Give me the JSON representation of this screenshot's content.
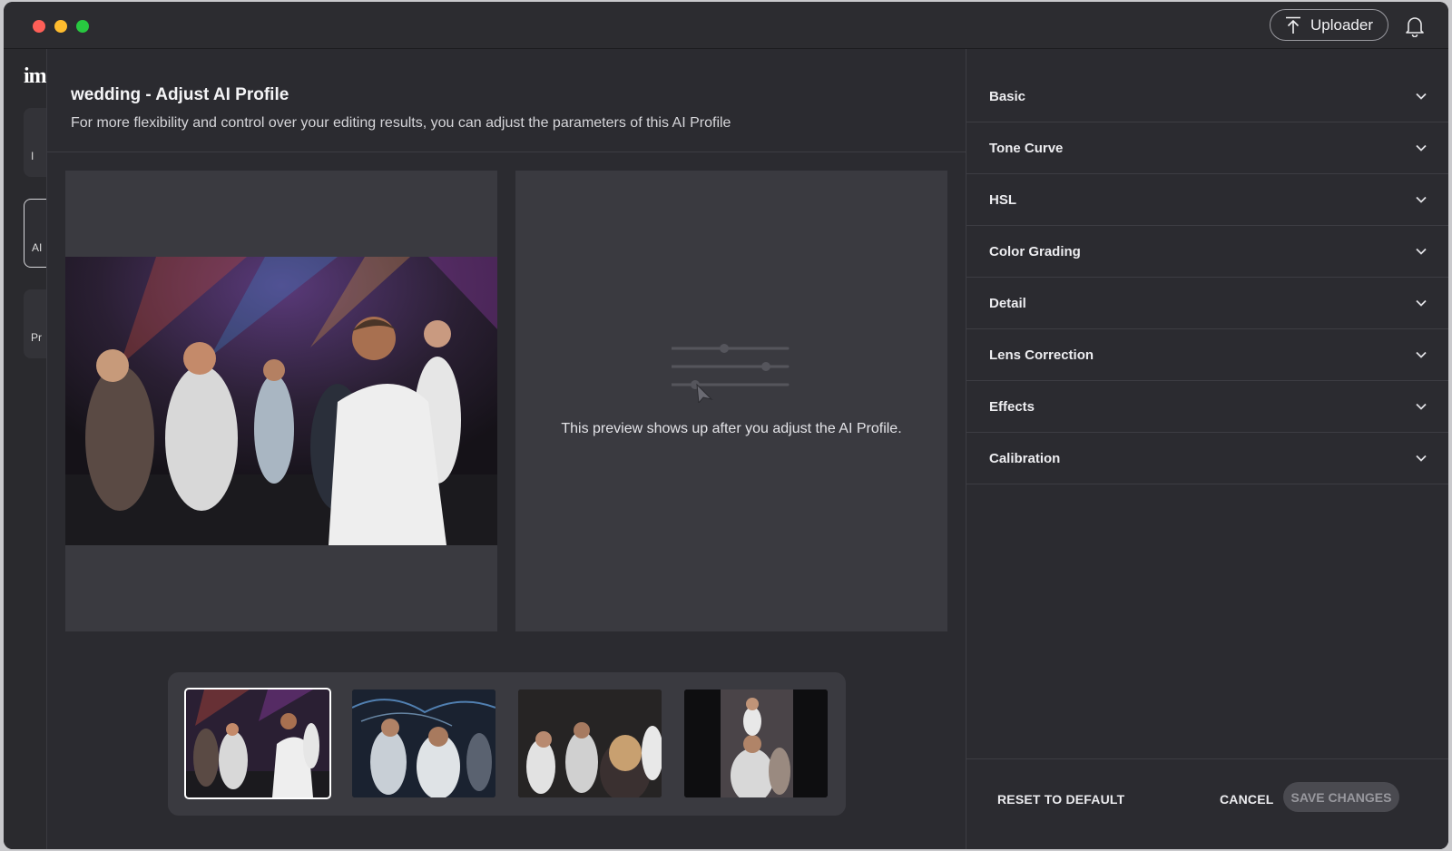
{
  "titlebar": {
    "uploader_label": "Uploader",
    "icons": [
      "upload-icon",
      "bell-icon"
    ]
  },
  "app_sidebar": {
    "logo_text": "im",
    "cards": [
      "I",
      "AI",
      "Pr"
    ]
  },
  "modal": {
    "title": "wedding - Adjust AI Profile",
    "subtitle": "For more flexibility and control over your editing results, you can adjust the parameters of this AI Profile",
    "preview_placeholder": "This preview shows up after you adjust the AI Profile.",
    "thumbnails": [
      {
        "name": "thumb-1",
        "selected": true
      },
      {
        "name": "thumb-2",
        "selected": false
      },
      {
        "name": "thumb-3",
        "selected": false
      },
      {
        "name": "thumb-4",
        "selected": false
      }
    ]
  },
  "settings": {
    "sections": [
      "Basic",
      "Tone Curve",
      "HSL",
      "Color Grading",
      "Detail",
      "Lens Correction",
      "Effects",
      "Calibration"
    ],
    "reset_label": "RESET TO DEFAULT",
    "cancel_label": "CANCEL",
    "save_label": "SAVE CHANGES"
  },
  "colors": {
    "window_bg": "#2a2a2e",
    "panel_bg": "#3a3a40",
    "accent_selected": "#ffffff",
    "save_disabled_bg": "#4a4a50"
  }
}
